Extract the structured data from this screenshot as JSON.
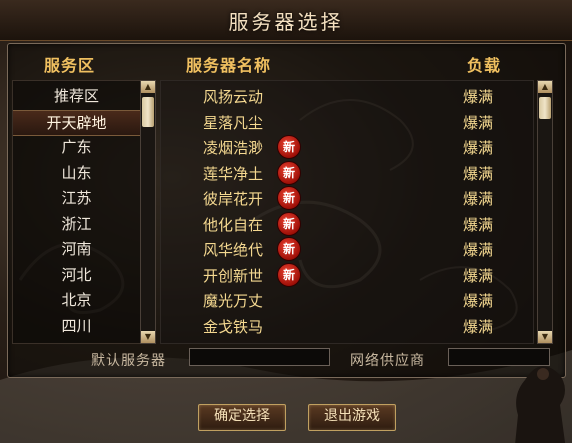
{
  "window": {
    "title": "服务器选择"
  },
  "headers": {
    "zone": "服务区",
    "server_name": "服务器名称",
    "load": "负载"
  },
  "zones": [
    {
      "label": "推荐区",
      "selected": false
    },
    {
      "label": "开天辟地",
      "selected": true
    },
    {
      "label": "广东",
      "selected": false
    },
    {
      "label": "山东",
      "selected": false
    },
    {
      "label": "江苏",
      "selected": false
    },
    {
      "label": "浙江",
      "selected": false
    },
    {
      "label": "河南",
      "selected": false
    },
    {
      "label": "河北",
      "selected": false
    },
    {
      "label": "北京",
      "selected": false
    },
    {
      "label": "四川",
      "selected": false
    }
  ],
  "servers": [
    {
      "name": "风扬云动",
      "is_new": false,
      "badge": "",
      "load": "爆满"
    },
    {
      "name": "星落凡尘",
      "is_new": false,
      "badge": "",
      "load": "爆满"
    },
    {
      "name": "凌烟浩渺",
      "is_new": true,
      "badge": "新",
      "load": "爆满"
    },
    {
      "name": "莲华净土",
      "is_new": true,
      "badge": "新",
      "load": "爆满"
    },
    {
      "name": "彼岸花开",
      "is_new": true,
      "badge": "新",
      "load": "爆满"
    },
    {
      "name": "他化自在",
      "is_new": true,
      "badge": "新",
      "load": "爆满"
    },
    {
      "name": "风华绝代",
      "is_new": true,
      "badge": "新",
      "load": "爆满"
    },
    {
      "name": "开创新世",
      "is_new": true,
      "badge": "新",
      "load": "爆满"
    },
    {
      "name": "魔光万丈",
      "is_new": false,
      "badge": "",
      "load": "爆满"
    },
    {
      "name": "金戈铁马",
      "is_new": false,
      "badge": "",
      "load": "爆满"
    }
  ],
  "footer": {
    "default_server_label": "默认服务器",
    "default_server_value": "",
    "isp_label": "网络供应商",
    "isp_value": ""
  },
  "buttons": {
    "confirm": "确定选择",
    "exit": "退出游戏"
  },
  "colors": {
    "header_gold": "#f0c060",
    "server_text": "#f4d890",
    "new_badge_red": "#c82010",
    "button_border": "#c0a060"
  }
}
